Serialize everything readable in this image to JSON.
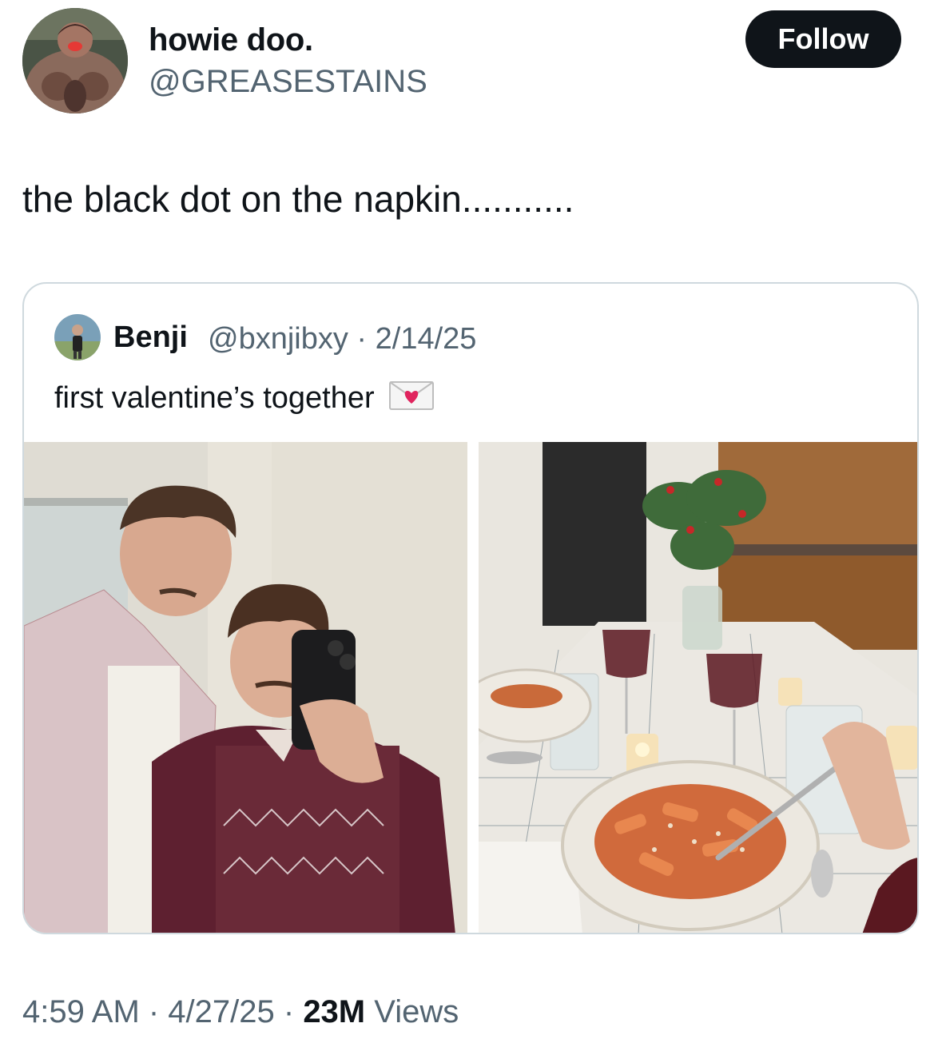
{
  "author": {
    "display_name": "howie doo.",
    "handle": "@GREASESTAINS",
    "avatar_icon": "avatar-photo"
  },
  "follow_label": "Follow",
  "tweet_text": "the black dot on the napkin...........",
  "quoted": {
    "name": "Benji",
    "handle_date": "@bxnjibxy · 2/14/25",
    "text": "first valentine’s together",
    "emoji_icon": "love-letter-icon"
  },
  "footer": {
    "time_date": "4:59 AM · 4/27/25 · ",
    "views_count": "23M",
    "views_label": " Views"
  },
  "colors": {
    "text": "#0f1419",
    "secondary": "#536471",
    "border": "#cfd9de",
    "button": "#0f1419"
  }
}
